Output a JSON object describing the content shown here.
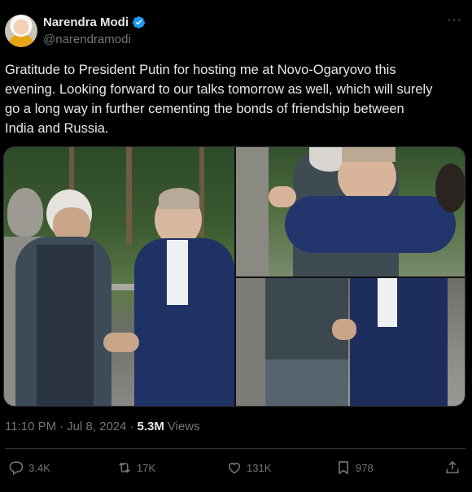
{
  "author": {
    "name": "Narendra Modi",
    "handle": "@narendramodi",
    "verified": true
  },
  "more_icon": "ellipsis-icon",
  "tweet": {
    "lines": [
      "Gratitude to President Putin for hosting me at Novo-Ogaryovo this",
      "evening. Looking forward to our talks tomorrow as well, which will surely",
      "go a long way in further cementing the bonds of friendship between",
      "India and Russia."
    ]
  },
  "meta": {
    "time": "11:10 PM",
    "separator": "·",
    "date": "Jul 8, 2024",
    "views_count": "5.3M",
    "views_label": "Views"
  },
  "actions": {
    "replies": "3.4K",
    "reposts": "17K",
    "likes": "131K",
    "bookmarks": "978"
  },
  "colors": {
    "background": "#000000",
    "text": "#e7e9ea",
    "muted": "#71767b",
    "border": "#2f3336",
    "verified": "#1d9bf0"
  }
}
